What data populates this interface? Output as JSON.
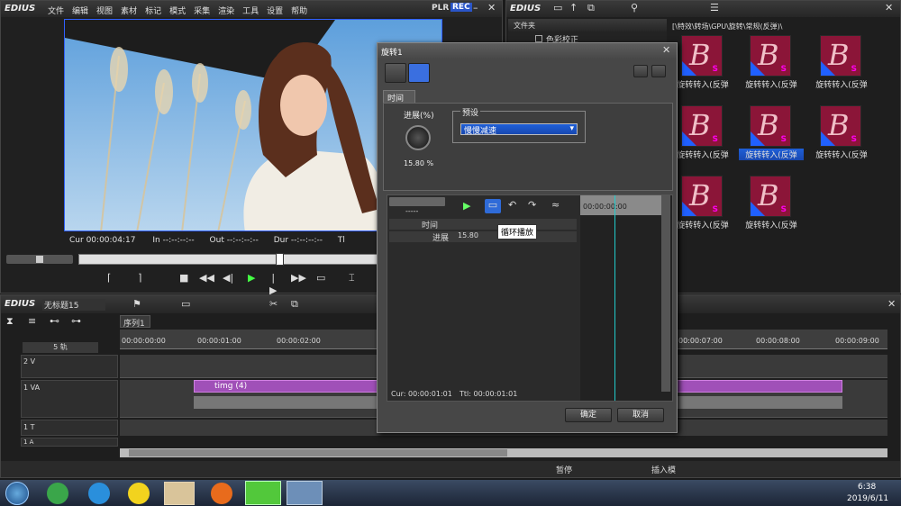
{
  "player": {
    "app_name": "EDIUS",
    "menu": [
      "文件",
      "编辑",
      "视图",
      "素材",
      "标记",
      "模式",
      "采集",
      "渲染",
      "工具",
      "设置",
      "帮助"
    ],
    "plr": "PLR",
    "rec": "REC",
    "timecode_labels": {
      "cur": "Cur",
      "in": "In",
      "out": "Out",
      "dur": "Dur",
      "ttl": "Tl"
    },
    "cur": "00:00:04:17",
    "in": "--:--:--:--",
    "out": "--:--:--:--",
    "dur": "--:--:--:--"
  },
  "bin": {
    "app_name": "EDIUS",
    "tree_header": "文件夹",
    "tree_item": "色彩校正",
    "path": "[\\特效\\转场\\GPU\\旋转\\常规(反弹)\\",
    "items": [
      {
        "label": "旋转转入(反弹",
        "selected": false
      },
      {
        "label": "旋转转入(反弹",
        "selected": false
      },
      {
        "label": "旋转转入(反弹",
        "selected": false
      },
      {
        "label": "旋转转入(反弹",
        "selected": false
      },
      {
        "label": "旋转转入(反弹",
        "selected": true
      },
      {
        "label": "旋转转入(反弹",
        "selected": false
      },
      {
        "label": "旋转转入(反弹",
        "selected": false
      },
      {
        "label": "旋转转入(反弹",
        "selected": false
      }
    ]
  },
  "dialog": {
    "title": "旋转1",
    "tab": "时间",
    "progress_label": "进展(%)",
    "progress_value": "15.80 %",
    "preset_label": "预设",
    "preset_value": "慢慢减速",
    "combo_value": "-----",
    "tracks": [
      {
        "label": "时间"
      },
      {
        "label": "进展",
        "value": "15.80"
      }
    ],
    "tooltip": "循环播放",
    "kf_time": "00:00:00:00",
    "cur_label": "Cur: 00:00:01:01",
    "ttl_label": "Ttl: 00:00:01:01",
    "ok": "确定",
    "cancel": "取消"
  },
  "timeline": {
    "app_name": "EDIUS",
    "project": "无标题15",
    "sequence_tab": "序列1",
    "track_count": "5 轨",
    "ruler": [
      "00:00:00:00",
      "00:00:01:00",
      "00:00:02:00",
      "00:00:07:00",
      "00:00:08:00",
      "00:00:09:00"
    ],
    "tracks": [
      "2 V",
      "1 VA",
      "1 T",
      "1 A"
    ],
    "clip_label": "timg (4)",
    "status_pause": "暂停",
    "status_insert": "插入模"
  },
  "taskbar": {
    "time": "6:38",
    "date": "2019/6/11"
  }
}
